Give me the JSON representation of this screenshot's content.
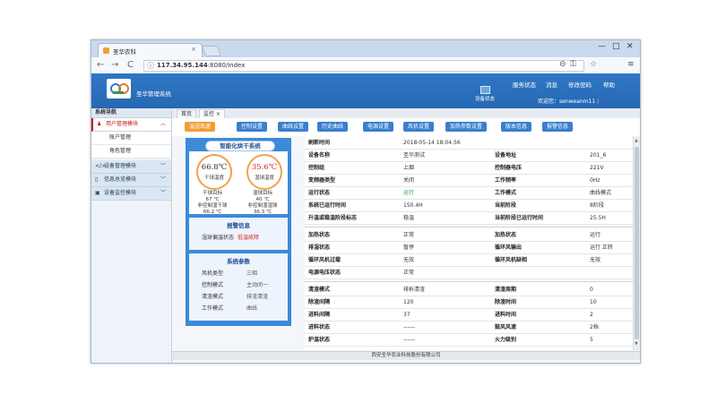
{
  "browser": {
    "tab_title": "圣华农科",
    "tab_close": "×",
    "url_host": "117.34.95.144",
    "url_path": ":8080/index",
    "win_min": "—",
    "win_max": "□",
    "win_close": "✕",
    "nav_back": "←",
    "nav_forward": "→",
    "nav_reload": "C",
    "info": "ⓘ",
    "zoom": "⊖",
    "key": "⚿",
    "star": "☆",
    "menu": "≡"
  },
  "header": {
    "app_title": "圣华管理系统",
    "links": [
      "服务状态",
      "消息",
      "修改密码",
      "帮助"
    ],
    "device_status": "设备状态",
    "welcome": "欢迎您：senweanm11",
    "sep": "|"
  },
  "sidebar": {
    "title": "系统导航",
    "groups": [
      {
        "icon": "♟",
        "label": "用户管理模块",
        "chevron": "︿"
      },
      {
        "icon": "</>",
        "label": "设备管理模块",
        "chevron": "﹀"
      },
      {
        "icon": "▯",
        "label": "信息总览模块",
        "chevron": "﹀"
      },
      {
        "icon": "▣",
        "label": "设备监控模块",
        "chevron": "﹀"
      }
    ],
    "subitems": [
      "账户管理",
      "角色管理"
    ]
  },
  "content": {
    "tabs": [
      "首页",
      "监控 ×"
    ],
    "toolbar": [
      "温湿风速",
      "控制设置",
      "曲线设置",
      "历史曲线",
      "电源设置",
      "风机设置",
      "加热参数设置",
      "版本信息",
      "报警信息"
    ],
    "footer": "西安圣华农业科技股份有限公司"
  },
  "left_panel": {
    "title": "智能化烘干系统",
    "gauge_left": {
      "value": "66.8℃",
      "name": "干球温度",
      "target_label": "干球目标",
      "target_value": "67 ℃",
      "ctrl_label": "非控制湿干球",
      "ctrl_value": "66.2 ℃"
    },
    "gauge_right": {
      "value": "35.6℃",
      "name": "湿球温度",
      "target_label": "湿球目标",
      "target_value": "40 ℃",
      "ctrl_label": "非控制湿湿球",
      "ctrl_value": "36.3 ℃"
    },
    "alarm": {
      "title": "报警信息",
      "label": "湿球偏温状态",
      "status": "低温故障"
    },
    "params": {
      "title": "系统参数",
      "rows": [
        {
          "k": "风机类型",
          "v": "三相"
        },
        {
          "k": "控制模式",
          "v": "主动闭一"
        },
        {
          "k": "清渣模式",
          "v": "排渣清渣"
        },
        {
          "k": "工作模式",
          "v": "曲线"
        }
      ]
    }
  },
  "table": {
    "rows": [
      [
        "刷新时间",
        "2018-05-14 18:04:56",
        "",
        ""
      ],
      [
        "设备名称",
        "圣华测试",
        "设备地址",
        "201_6"
      ],
      [
        "控制组",
        "上烟",
        "控制器电压",
        "221V"
      ],
      [
        "变频器类型",
        "关闭",
        "工作频率",
        "0Hz"
      ],
      [
        "运行状态",
        "运行",
        "工作模式",
        "曲线模式"
      ],
      [
        "系统已运行时间",
        "150.4H",
        "当前阶段",
        "8阶段"
      ],
      [
        "升温或稳温阶段标志",
        "稳温",
        "当前阶段已运行时间",
        "25.5H"
      ],
      [
        "加热状态",
        "正常",
        "加热状态",
        "运行"
      ],
      [
        "排湿状态",
        "暂停",
        "循环风输出",
        "运行 正转"
      ],
      [
        "循环风机过载",
        "无效",
        "循环风机缺相",
        "无效"
      ],
      [
        "电源电压状态",
        "正常",
        "",
        ""
      ],
      [
        "清渣模式",
        "排析清渣",
        "清渣周期",
        "0"
      ],
      [
        "除渣间隔",
        "120",
        "除渣时间",
        "10"
      ],
      [
        "进料间隔",
        "37",
        "进料时间",
        "2"
      ],
      [
        "进料状态",
        "------",
        "鼓风风速",
        "2档"
      ],
      [
        "炉温状态",
        "------",
        "火力级别",
        "5"
      ]
    ]
  },
  "scroll": {
    "up": "▲",
    "down": "▼"
  }
}
